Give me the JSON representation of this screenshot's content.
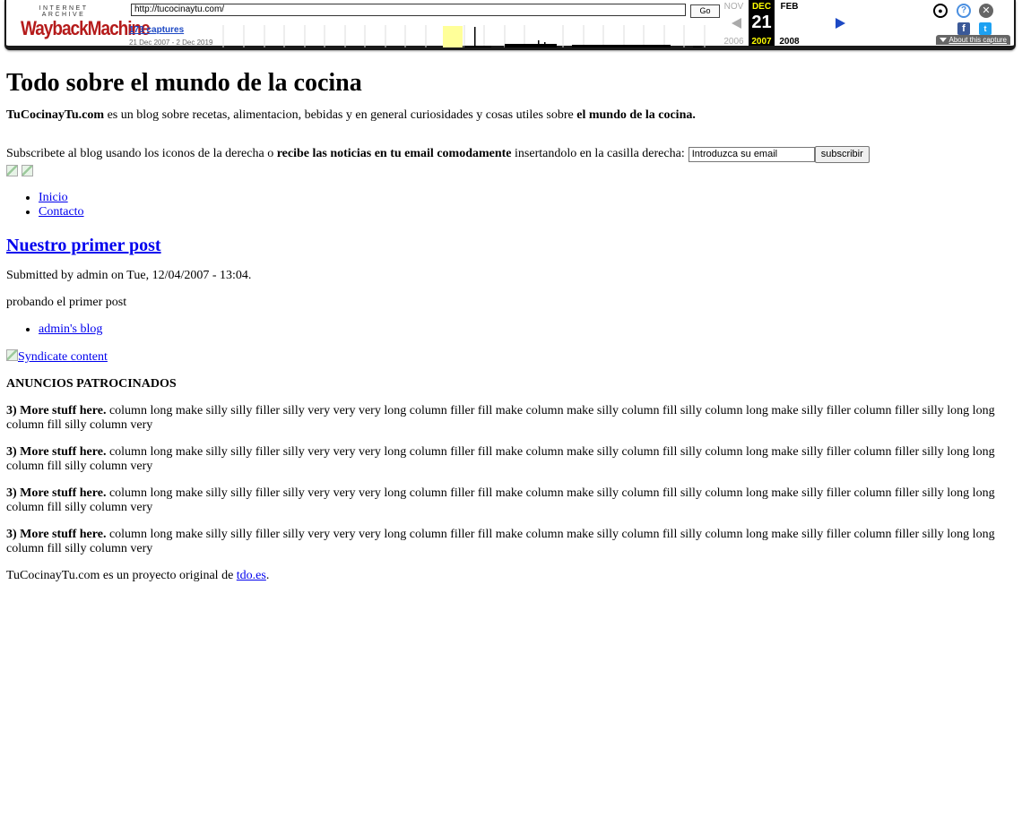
{
  "wayback": {
    "logo_top": "INTERNET ARCHIVE",
    "logo_main": "WaybackMachine",
    "url": "http://tucocinaytu.com/",
    "go_label": "Go",
    "captures_link": "173 captures",
    "date_range": "21 Dec 2007 - 2 Dec 2019",
    "prev_month": "NOV",
    "cur_month": "DEC",
    "next_month": "FEB",
    "cur_day": "21",
    "prev_year": "2006",
    "cur_year": "2007",
    "next_year": "2008",
    "about_label": "About this capture",
    "icons": [
      "user-icon",
      "help-icon",
      "close-icon",
      "facebook-icon",
      "twitter-icon"
    ],
    "colors": {
      "accent": "#1d49c4",
      "logo_red": "#b51b1b",
      "highlight": "#ffff00"
    }
  },
  "site": {
    "title": "Todo sobre el mundo de la cocina",
    "intro_brand": "TuCocinayTu.com",
    "intro_mid": " es un blog sobre recetas, alimentacion, bebidas y en general curiosidades y cosas utiles sobre ",
    "intro_end": "el mundo de la cocina.",
    "subscribe_pre": "Subscribete al blog usando los iconos de la derecha o ",
    "subscribe_bold": "recibe las noticias en tu email comodamente",
    "subscribe_post": " insertandolo en la casilla derecha:",
    "email_value": "Introduzca su email",
    "subscribe_button": "subscribir",
    "menu": [
      "Inicio",
      "Contacto"
    ]
  },
  "post": {
    "title": "Nuestro primer post",
    "meta": "Submitted by admin on Tue, 12/04/2007 - 13:04.",
    "body": "probando el primer post",
    "links": [
      "admin's blog"
    ]
  },
  "sidebar": {
    "syndicate_alt": "Syndicate content",
    "ads_heading": "ANUNCIOS PATROCINADOS",
    "ads": [
      {
        "lead": "3) More stuff here.",
        "text": " column long make silly silly filler silly very very very long column filler fill make column make silly column fill silly column long make silly filler column filler silly long long column fill silly column very"
      },
      {
        "lead": "3) More stuff here.",
        "text": " column long make silly silly filler silly very very very long column filler fill make column make silly column fill silly column long make silly filler column filler silly long long column fill silly column very"
      },
      {
        "lead": "3) More stuff here.",
        "text": " column long make silly silly filler silly very very very long column filler fill make column make silly column fill silly column long make silly filler column filler silly long long column fill silly column very"
      },
      {
        "lead": "3) More stuff here.",
        "text": " column long make silly silly filler silly very very very long column filler fill make column make silly column fill silly column long make silly filler column filler silly long long column fill silly column very"
      }
    ]
  },
  "footer": {
    "text": "TuCocinayTu.com es un proyecto original de ",
    "link": "tdo.es",
    "end": "."
  }
}
